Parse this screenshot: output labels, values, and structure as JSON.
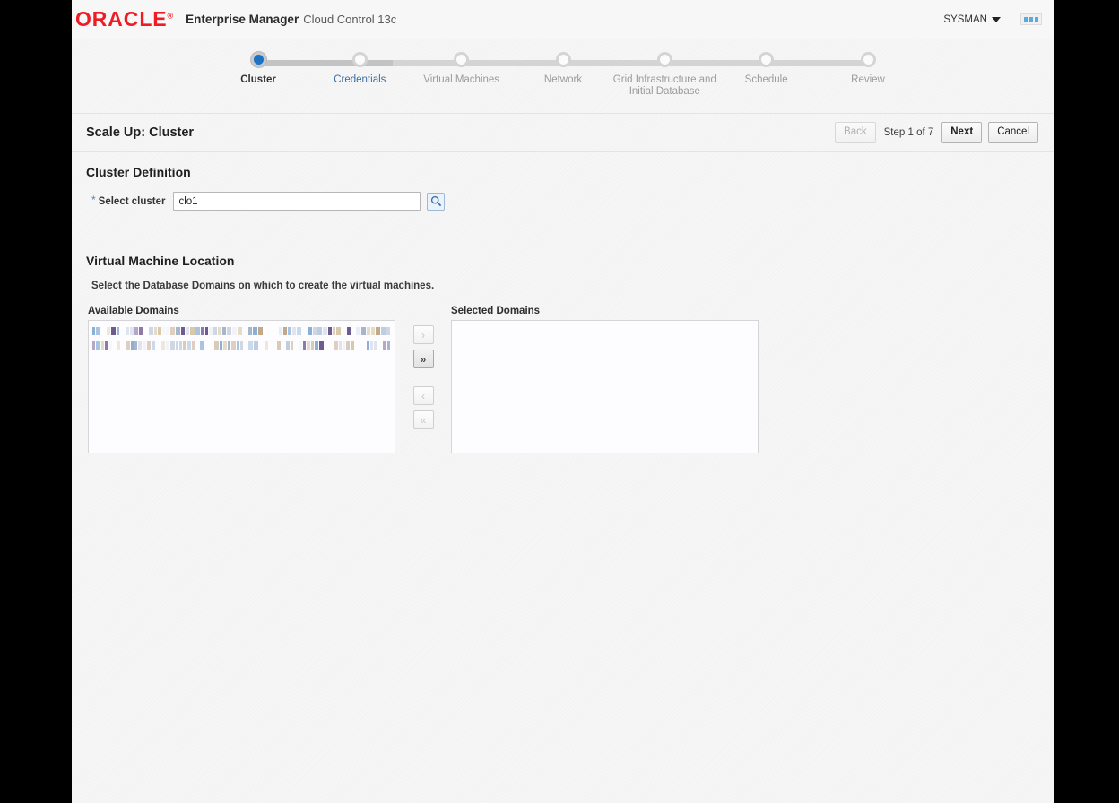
{
  "branding": {
    "logo_text": "ORACLE",
    "logo_reg": "®",
    "app_name": "Enterprise Manager",
    "app_sub": "Cloud Control 13c",
    "user": "SYSMAN",
    "user_caret_icon": "chevron-down-icon",
    "grid_icon": "app-grid-icon"
  },
  "train": {
    "steps": [
      {
        "label": "Cluster",
        "state": "active"
      },
      {
        "label": "Credentials",
        "state": "link"
      },
      {
        "label": "Virtual Machines",
        "state": "disabled"
      },
      {
        "label": "Network",
        "state": "disabled"
      },
      {
        "label": "Grid Infrastructure and Initial Database",
        "state": "disabled"
      },
      {
        "label": "Schedule",
        "state": "disabled"
      },
      {
        "label": "Review",
        "state": "disabled"
      }
    ]
  },
  "page": {
    "title": "Scale Up: Cluster",
    "back_label": "Back",
    "step_counter": "Step 1 of 7",
    "next_label": "Next",
    "cancel_label": "Cancel"
  },
  "cluster_definition": {
    "heading": "Cluster Definition",
    "required_marker": "*",
    "select_cluster_label": "Select cluster",
    "select_cluster_value": "clo1",
    "select_cluster_placeholder": "",
    "search_icon": "search-icon"
  },
  "vm_location": {
    "heading": "Virtual Machine Location",
    "hint": "Select the Database Domains on which to create the virtual machines.",
    "available_label": "Available Domains",
    "selected_label": "Selected Domains",
    "available_items": [
      {
        "redacted": true
      },
      {
        "redacted": true
      }
    ],
    "selected_items": [],
    "transfer_buttons": [
      {
        "icon": "chevron-right-icon",
        "glyph": "›",
        "enabled": false,
        "name": "move-right-button"
      },
      {
        "icon": "chevron-double-right-icon",
        "glyph": "»",
        "enabled": true,
        "name": "move-all-right-button"
      },
      {
        "icon": "chevron-left-icon",
        "glyph": "‹",
        "enabled": false,
        "name": "move-left-button"
      },
      {
        "icon": "chevron-double-left-icon",
        "glyph": "«",
        "enabled": false,
        "name": "move-all-left-button"
      }
    ]
  },
  "colors": {
    "brand_red": "#ee1c25",
    "active_step_blue": "#1a73c4",
    "link_blue": "#3a6ea5",
    "page_bg": "#f6f6f7"
  }
}
